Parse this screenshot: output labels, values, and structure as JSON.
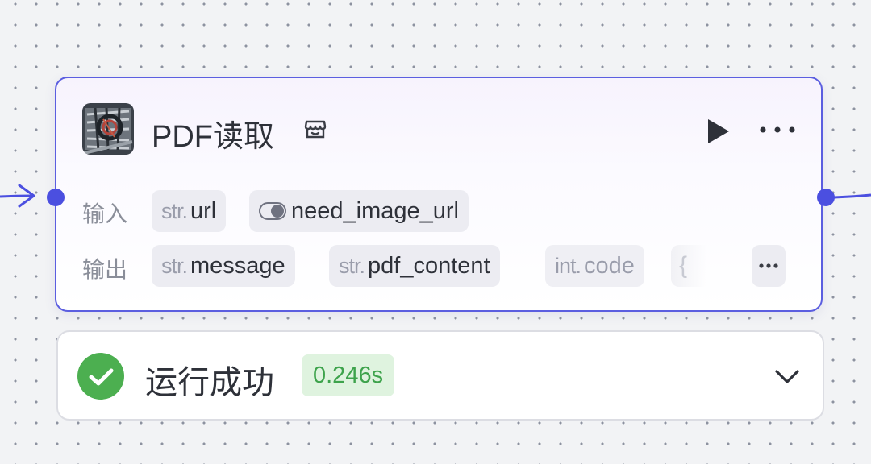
{
  "node": {
    "title": "PDF读取",
    "icons": {
      "node": "pdf-reader-thumbnail-icon",
      "store": "store-icon",
      "run": "play-icon",
      "more": "more-horizontal-icon"
    },
    "inputs_label": "输入",
    "inputs": [
      {
        "type": "str.",
        "name": "url"
      },
      {
        "type": "toggle",
        "name": "need_image_url"
      }
    ],
    "outputs_label": "输出",
    "outputs": [
      {
        "type": "str.",
        "name": "message"
      },
      {
        "type": "str.",
        "name": "pdf_content"
      },
      {
        "type": "int.",
        "name": "code"
      },
      {
        "type": "",
        "name": "{"
      }
    ],
    "more_outputs_label": "···",
    "accent_color": "#5b5ee0"
  },
  "result": {
    "status": "运行成功",
    "duration": "0.246s",
    "status_color": "#4caf50",
    "icons": {
      "status": "check-circle-icon",
      "expand": "chevron-down-icon"
    }
  }
}
